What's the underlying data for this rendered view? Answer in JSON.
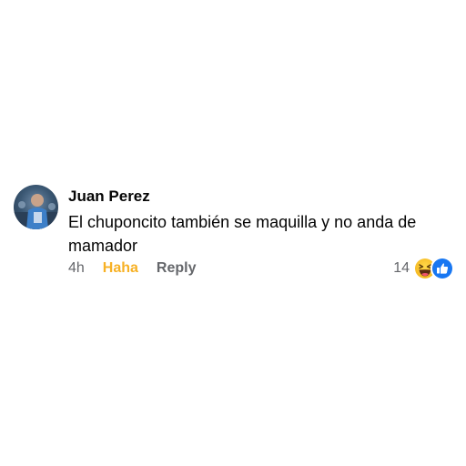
{
  "comment": {
    "author": "Juan Perez",
    "text": "El chuponcito también se maquilla y no anda de mamador",
    "time": "4h",
    "reaction_label": "Haha",
    "reply_label": "Reply",
    "reaction_count": "14",
    "reaction_icons": [
      "haha-emoji-icon",
      "like-thumb-icon"
    ],
    "colors": {
      "haha": "#f7b125",
      "like": "#1877f2",
      "meta": "#65676b",
      "text": "#050505"
    }
  }
}
